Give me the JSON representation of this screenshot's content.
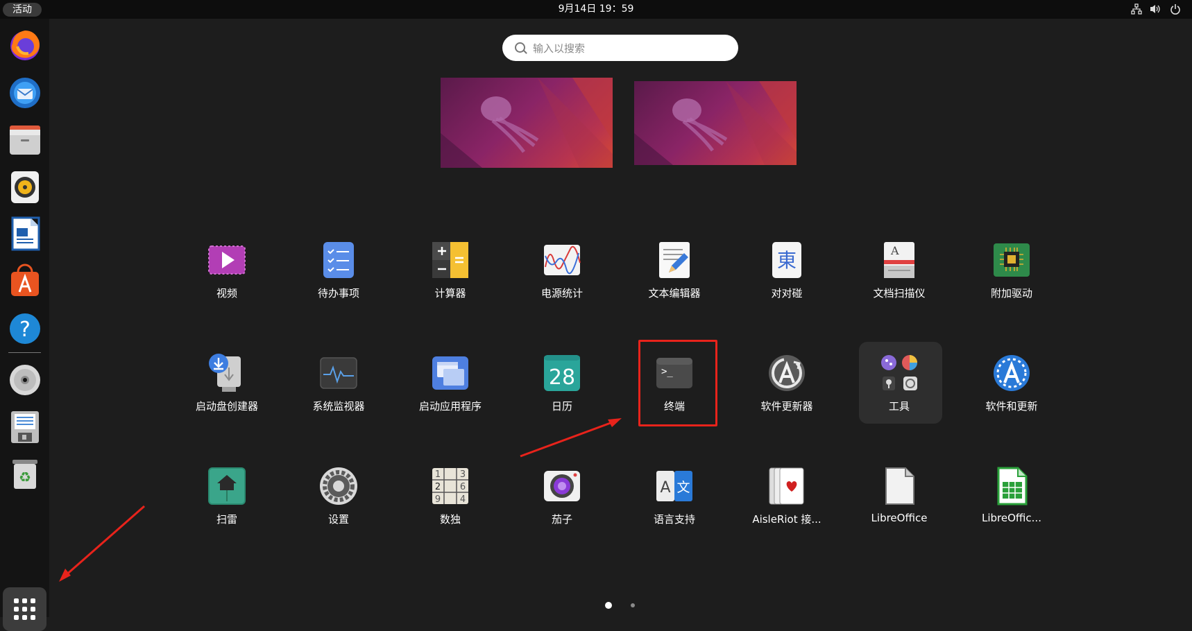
{
  "topbar": {
    "activities_label": "活动",
    "clock": "9月14日  19：59",
    "tray_icons": [
      "network-icon",
      "volume-icon",
      "power-icon"
    ]
  },
  "search": {
    "placeholder": "输入以搜索"
  },
  "dock": {
    "items": [
      {
        "name": "firefox-icon"
      },
      {
        "name": "thunderbird-icon"
      },
      {
        "name": "files-icon"
      },
      {
        "name": "rhythmbox-icon"
      },
      {
        "name": "libreoffice-writer-icon"
      },
      {
        "name": "app-center-icon"
      },
      {
        "name": "help-icon"
      },
      {
        "name": "disc-icon"
      },
      {
        "name": "floppy-save-icon"
      },
      {
        "name": "trash-icon"
      }
    ],
    "show_apps": "show-apps-grid-icon"
  },
  "apps": {
    "row1": [
      "视频",
      "待办事项",
      "计算器",
      "电源统计",
      "文本编辑器",
      "对对碰",
      "文档扫描仪",
      "附加驱动"
    ],
    "row2": [
      "启动盘创建器",
      "系统监视器",
      "启动应用程序",
      "日历",
      "终端",
      "软件更新器",
      "工具",
      "软件和更新"
    ],
    "row3": [
      "扫雷",
      "设置",
      "数独",
      "茄子",
      "语言支持",
      "AisleRiot 接...",
      "LibreOffice",
      "LibreOffic..."
    ]
  },
  "icon_text": {
    "calendar_day": "28",
    "mahjongg_glyph": "東",
    "terminal_prompt": ">_",
    "lang_a": "A",
    "lang_wen": "文",
    "scanner_a": "A",
    "sudoku_digits": [
      "1",
      "3",
      "2",
      "6",
      "9",
      "4"
    ]
  },
  "pager": {
    "pages": 2,
    "current": 1
  },
  "colors": {
    "accent_annotation": "#e8231b",
    "background": "#1d1d1d",
    "topbar": "#0d0d0d"
  }
}
